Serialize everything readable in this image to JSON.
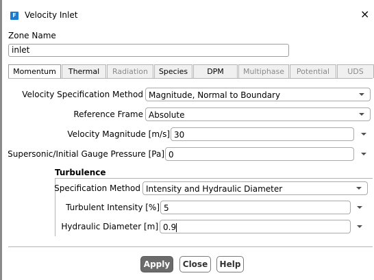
{
  "window": {
    "title": "Velocity Inlet",
    "app_icon_letter": "F",
    "close_glyph": "×"
  },
  "zone": {
    "label": "Zone Name",
    "value": "inlet"
  },
  "tabs": [
    {
      "label": "Momentum",
      "state": "active"
    },
    {
      "label": "Thermal",
      "state": "enabled"
    },
    {
      "label": "Radiation",
      "state": "disabled"
    },
    {
      "label": "Species",
      "state": "enabled"
    },
    {
      "label": "DPM",
      "state": "enabled"
    },
    {
      "label": "Multiphase",
      "state": "disabled"
    },
    {
      "label": "Potential",
      "state": "disabled"
    },
    {
      "label": "UDS",
      "state": "disabled"
    }
  ],
  "momentum": {
    "velocity_spec": {
      "label": "Velocity Specification Method",
      "value": "Magnitude, Normal to Boundary"
    },
    "reference_frame": {
      "label": "Reference Frame",
      "value": "Absolute"
    },
    "velocity_magnitude": {
      "label": "Velocity Magnitude [m/s]",
      "value": "30"
    },
    "gauge_pressure": {
      "label": "Supersonic/Initial Gauge Pressure [Pa]",
      "value": "0"
    }
  },
  "turbulence": {
    "heading": "Turbulence",
    "spec_method": {
      "label": "Specification Method",
      "value": "Intensity and Hydraulic Diameter"
    },
    "intensity": {
      "label": "Turbulent Intensity [%]",
      "value": "5"
    },
    "hydraulic_diameter": {
      "label": "Hydraulic Diameter [m]",
      "value": "0.9"
    }
  },
  "buttons": {
    "apply": "Apply",
    "close": "Close",
    "help": "Help"
  },
  "icons": {
    "app": "fluent-app-icon",
    "close": "close-icon",
    "dropdown": "chevron-down-icon"
  },
  "colors": {
    "app_icon": "#1d7ad3",
    "apply_bg": "#6b6b6b"
  }
}
